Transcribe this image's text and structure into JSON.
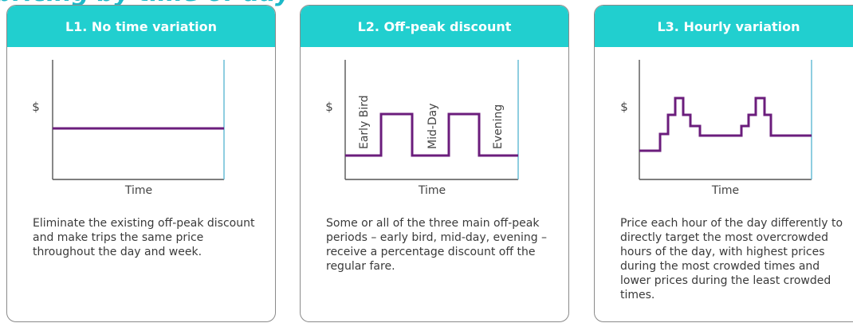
{
  "cards": [
    {
      "title": "L1. No time variation",
      "y_symbol": "$",
      "x_label": "Time",
      "description": "Eliminate the existing off-peak discount and make trips the same price throughout the day and week.",
      "period_labels": []
    },
    {
      "title": "L2. Off-peak discount",
      "y_symbol": "$",
      "x_label": "Time",
      "description": "Some or all of the three main off-peak periods – early bird, mid-day, evening – receive a percentage discount off the regular fare.",
      "period_labels": [
        "Early Bird",
        "Mid-Day",
        "Evening"
      ]
    },
    {
      "title": "L3. Hourly variation",
      "y_symbol": "$",
      "x_label": "Time",
      "description": "Price each hour of the day differently to directly target the most overcrowded hours of the day, with highest prices during the most crowded times and lower prices during the least crowded times.",
      "period_labels": []
    }
  ],
  "colors": {
    "header_bg": "#21cfcf",
    "line": "#6b1d7c",
    "axis": "#555555",
    "right_edge": "#5fb8d2"
  }
}
